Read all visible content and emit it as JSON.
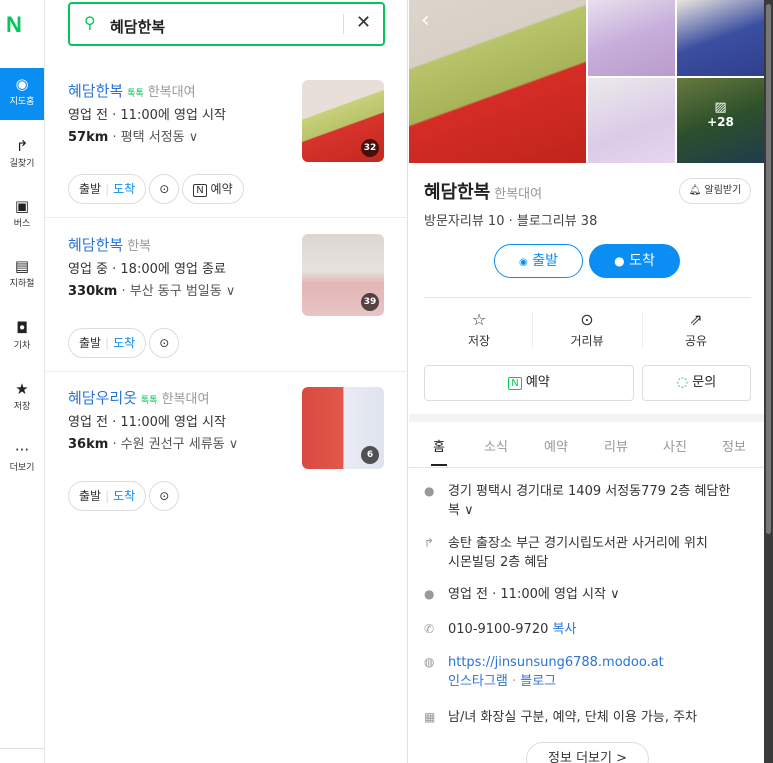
{
  "rail": {
    "logo": "N",
    "items": [
      {
        "label": "지도홈",
        "icon": "map-pin-icon",
        "glyph": "◉"
      },
      {
        "label": "길찾기",
        "icon": "directions-icon",
        "glyph": "↱"
      },
      {
        "label": "버스",
        "icon": "bus-icon",
        "glyph": "▣"
      },
      {
        "label": "지하철",
        "icon": "subway-icon",
        "glyph": "▤"
      },
      {
        "label": "기차",
        "icon": "train-icon",
        "glyph": "◘"
      },
      {
        "label": "저장",
        "icon": "star-icon",
        "glyph": "★"
      },
      {
        "label": "더보기",
        "icon": "more-icon",
        "glyph": "···"
      }
    ]
  },
  "search": {
    "query": "혜담한복"
  },
  "results": [
    {
      "name": "혜담한복",
      "talk": "톡톡",
      "category": "한복대여",
      "status": "영업 전 · 11:00에 영업 시작",
      "distance": "57km",
      "location": "· 평택 서정동 ∨",
      "photo_count": "32",
      "depart": "출발",
      "arrive": "도착",
      "reserve": "예약"
    },
    {
      "name": "혜담한복",
      "talk": "",
      "category": "한복",
      "status": "영업 중 · 18:00에 영업 종료",
      "distance": "330km",
      "location": "· 부산 동구 범일동 ∨",
      "photo_count": "39",
      "depart": "출발",
      "arrive": "도착",
      "reserve": ""
    },
    {
      "name": "혜담우리옷",
      "talk": "톡톡",
      "category": "한복대여",
      "status": "영업 전 · 11:00에 영업 시작",
      "distance": "36km",
      "location": "· 수원 권선구 세류동 ∨",
      "photo_count": "6",
      "depart": "출발",
      "arrive": "도착",
      "reserve": ""
    }
  ],
  "detail": {
    "photo_more": "+28",
    "title": "혜담한복",
    "category": "한복대여",
    "alarm_label": "알림받기",
    "reviews": "방문자리뷰 10 · 블로그리뷰 38",
    "depart_label": "출발",
    "arrive_label": "도착",
    "actions": {
      "save": "저장",
      "distance_view": "거리뷰",
      "share": "공유"
    },
    "reserve_label": "예약",
    "inquiry_label": "문의",
    "tabs": [
      "홈",
      "소식",
      "예약",
      "리뷰",
      "사진",
      "정보"
    ],
    "address": "경기 평택시 경기대로 1409 서정동779 2층 혜담한",
    "address2": "복 ∨",
    "directions": "송탄 출장소 부근 경기시립도서관 사거리에 위치",
    "directions2": "시몬빌딩 2층 혜담",
    "hours": "영업 전 · 11:00에 영업 시작 ∨",
    "phone": "010-9100-9720",
    "copy": "복사",
    "website": "https://jinsunsung6788.modoo.at",
    "instagram": "인스타그램",
    "dot": "·",
    "blog": "블로그",
    "amenities": "남/녀 화장실 구분, 예약, 단체 이용 가능, 주차",
    "more_info": "정보 더보기 >"
  },
  "colors": {
    "brand": "#03c75a",
    "accent": "#0a8ef3",
    "link": "#2a74d8"
  }
}
